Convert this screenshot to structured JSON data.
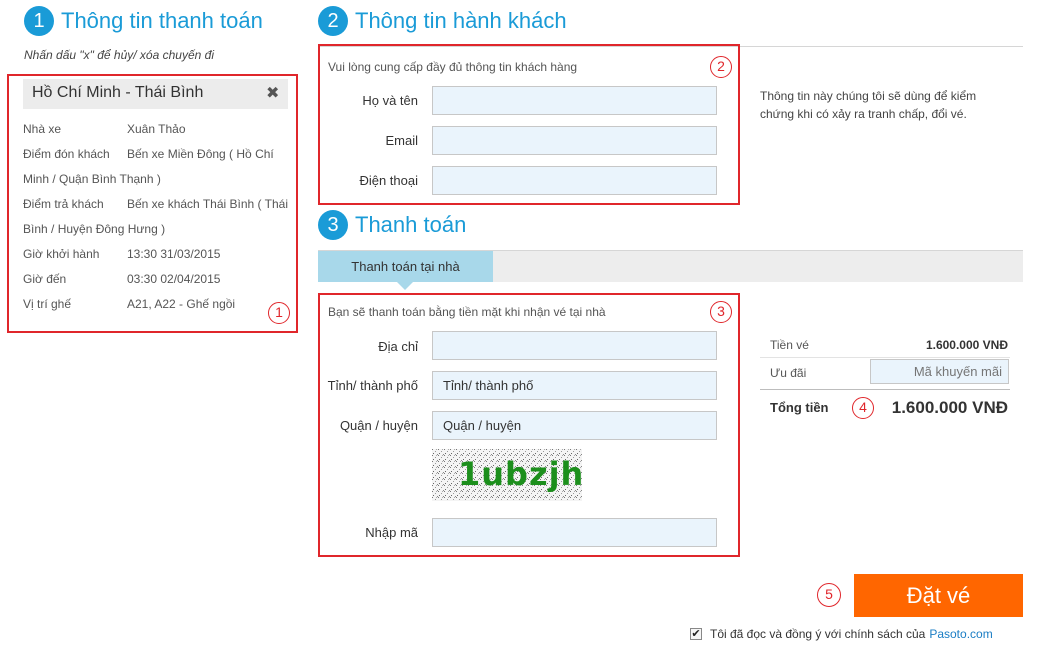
{
  "section1": {
    "number": "1",
    "title": "Thông tin thanh toán",
    "hint": "Nhấn dấu \"x\" để hủy/ xóa chuyến đi",
    "marker": "1",
    "trip": {
      "route": "Hồ Chí Minh - Thái Bình",
      "close_icon": "✖",
      "operator_label": "Nhà xe",
      "operator_value": "Xuân Thảo",
      "pickup_label": "Điểm đón khách",
      "pickup_value_line1": "Bến xe Miền Đông ( Hồ Chí",
      "pickup_value_line2": "Minh / Quận Bình Thạnh )",
      "dropoff_label": "Điểm trả khách",
      "dropoff_value_line1": "Bến xe khách Thái Bình ( Thái",
      "dropoff_value_line2": "Bình / Huyện Đông Hưng )",
      "depart_label": "Giờ khởi hành",
      "depart_value": "13:30 31/03/2015",
      "arrive_label": "Giờ đến",
      "arrive_value": "03:30 02/04/2015",
      "seat_label": "Vị trí ghế",
      "seat_value": "A21, A22 - Ghế ngồi"
    }
  },
  "section2": {
    "number": "2",
    "title": "Thông tin hành khách",
    "marker": "2",
    "instruction": "Vui lòng cung cấp đầy đủ thông tin khách hàng",
    "name_label": "Họ và tên",
    "name_value": "",
    "email_label": "Email",
    "email_value": "",
    "phone_label": "Điện thoại",
    "phone_value": "",
    "side_note": "Thông tin này chúng tôi sẽ dùng để kiểm chứng khi có xảy ra tranh chấp, đổi vé."
  },
  "section3": {
    "number": "3",
    "title": "Thanh toán",
    "tab_label": "Thanh toán tại nhà",
    "marker": "3",
    "instruction": "Bạn sẽ thanh toán bằng tiền mặt khi nhận vé tại nhà",
    "address_label": "Địa chỉ",
    "address_value": "",
    "city_label": "Tỉnh/ thành phố",
    "city_value": "Tỉnh/ thành phố",
    "district_label": "Quận / huyện",
    "district_value": "Quận / huyện",
    "captcha_text": "1ubzjh",
    "captcha_label": "Nhập mã",
    "captcha_value": ""
  },
  "summary": {
    "ticket_label": "Tiền vé",
    "ticket_value": "1.600.000 VNĐ",
    "promo_label": "Ưu đãi",
    "promo_placeholder": "Mã khuyến mãi",
    "total_label": "Tổng tiền",
    "marker": "4",
    "total_value": "1.600.000 VNĐ"
  },
  "submit": {
    "marker": "5",
    "button_label": "Đặt vé",
    "agree_text": "Tôi đã đọc và đồng ý với chính sách của",
    "agree_link": "Pasoto.com",
    "agree_checked": true
  },
  "colors": {
    "accent": "#1a9bd7",
    "marker_red": "#e0262b",
    "button_orange": "#ff6600",
    "input_bg": "#eaf4fc",
    "captcha_green": "#1c8f1c"
  }
}
